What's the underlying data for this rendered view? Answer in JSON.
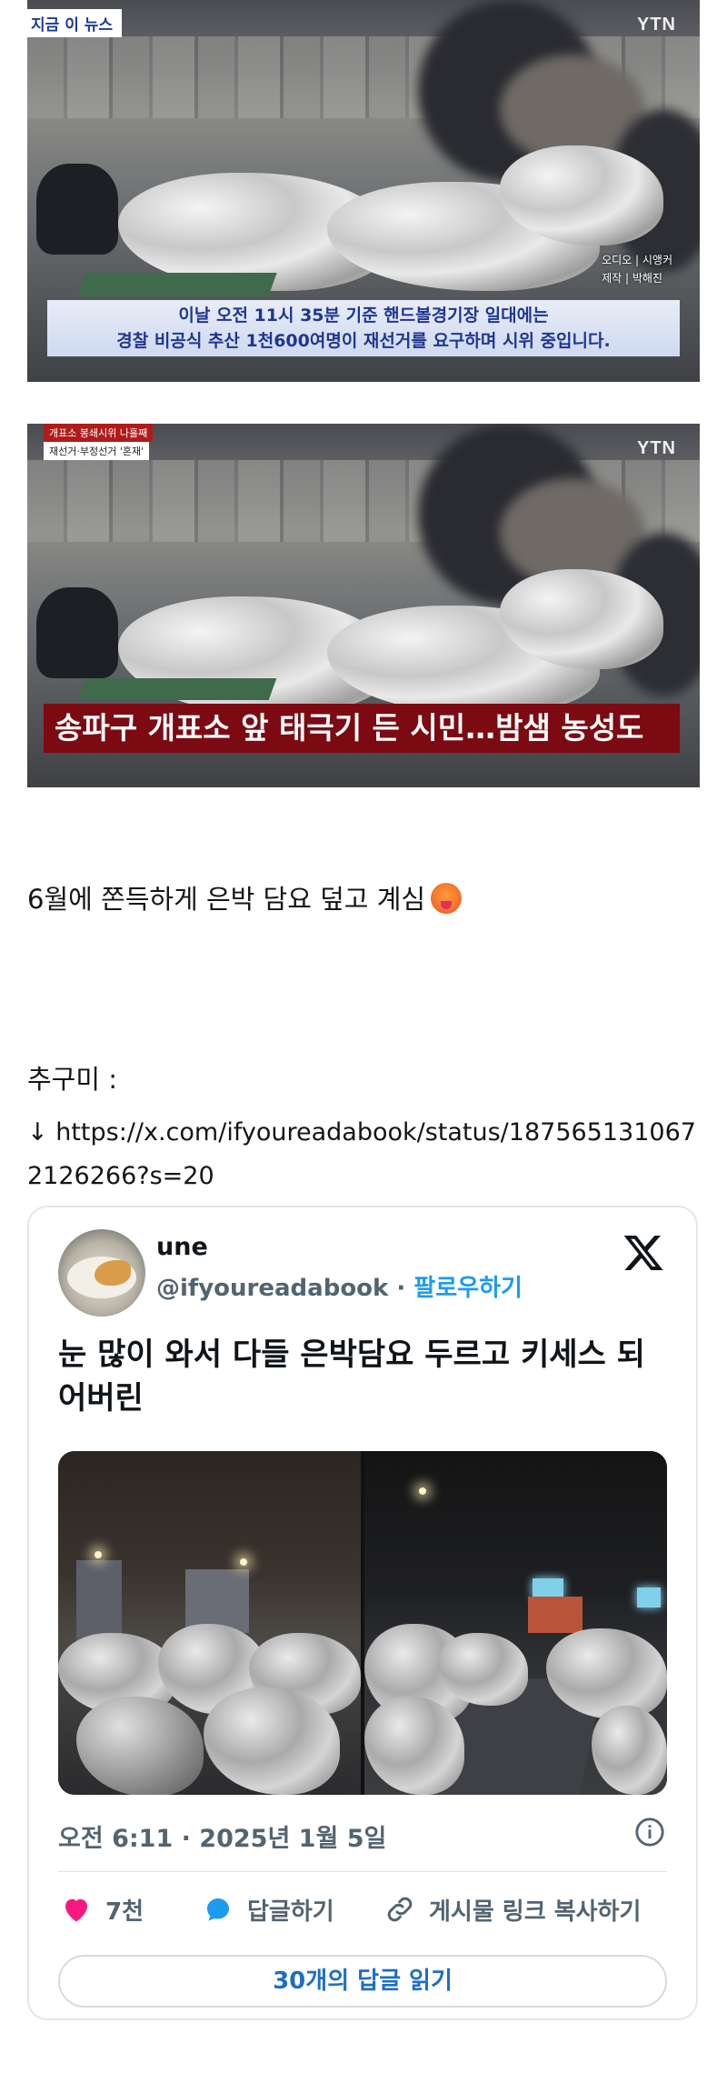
{
  "still1": {
    "badge": "지금 이 뉴스",
    "logo": "YTN",
    "credit_line1": "오디오 | 시앵커",
    "credit_line2": "제작 | 박해진",
    "caption_line1": "이날 오전 11시 35분 기준 핸드볼경기장 일대에는",
    "caption_line2": "경찰 비공식 추산 1천600여명이 재선거를 요구하며 시위 중입니다."
  },
  "still2": {
    "logo": "YTN",
    "tag_red": "개표소 봉쇄시위 나흘째",
    "tag_white": "재선거·부정선거 '혼재'",
    "caption": "송파구 개표소 앞 태극기 든 시민…밤샘 농성도"
  },
  "post": {
    "line1": "6월에 쫀득하게 은박 담요 덮고 계심",
    "line2": "추구미 :",
    "arrow": "↓",
    "link": "https://x.com/ifyoureadabook/status/1875651310672126266?s=20"
  },
  "tweet": {
    "display_name": "une",
    "handle": "@ifyoureadabook",
    "separator": " · ",
    "follow": "팔로우하기",
    "text": "눈 많이 와서 다들 은박담요 두르고 키세스 되어버린",
    "timestamp": "오전 6:11 · 2025년 1월 5일",
    "like_count": "7천",
    "reply_label": "답글하기",
    "copy_label": "게시물 링크 복사하기",
    "read_replies": "30개의 답글 읽기"
  },
  "colors": {
    "ytn_blue": "#1f3691",
    "caption_red": "#7c0a12",
    "like_pink": "#f91880",
    "reply_blue": "#1d9bf0",
    "link_blue": "#1d6fc4"
  },
  "icons": [
    "x-logo-icon",
    "info-icon",
    "heart-icon",
    "speech-bubble-icon",
    "link-icon",
    "emoji-icon"
  ]
}
